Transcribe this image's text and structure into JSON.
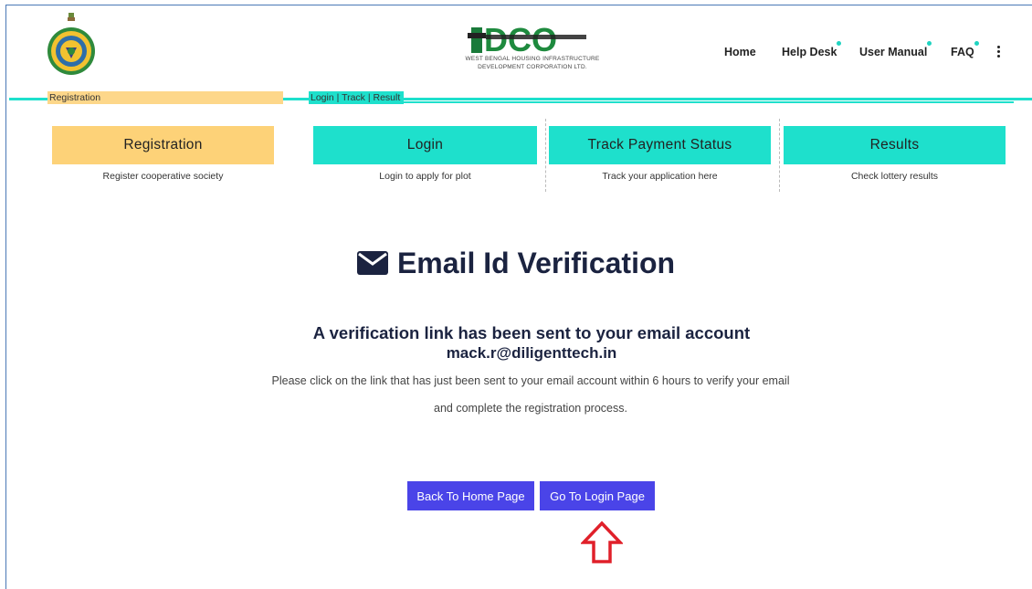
{
  "header": {
    "logo_text": "WEST BENGAL HOUSING INFRASTRUCTURE DEVELOPMENT CORPORATION LTD.",
    "nav": [
      {
        "label": "Home"
      },
      {
        "label": "Help Desk"
      },
      {
        "label": "User Manual"
      },
      {
        "label": "FAQ"
      }
    ]
  },
  "tags": {
    "registration": "Registration",
    "login_track": "Login | Track | Result"
  },
  "cards": [
    {
      "label": "Registration",
      "sub": "Register cooperative society",
      "color": "#fdd278"
    },
    {
      "label": "Login",
      "sub": "Login to apply for plot",
      "color": "#1ee0cc"
    },
    {
      "label": "Track Payment Status",
      "sub": "Track your application here",
      "color": "#1ee0cc"
    },
    {
      "label": "Results",
      "sub": "Check lottery results",
      "color": "#1ee0cc"
    }
  ],
  "main": {
    "title": "Email Id Verification",
    "message": "A verification link has been sent to your email account",
    "email": "mack.r@diligenttech.in",
    "info_line1": "Please click on the link that has just been sent to your email account within 6 hours to verify your email",
    "info_line2": "and complete the registration process.",
    "back_button": "Back To Home Page",
    "login_button": "Go To Login Page"
  },
  "colors": {
    "accent_teal": "#1ee0cc",
    "accent_yellow": "#fdd278",
    "button": "#4a44e8",
    "arrow": "#e0202a"
  }
}
